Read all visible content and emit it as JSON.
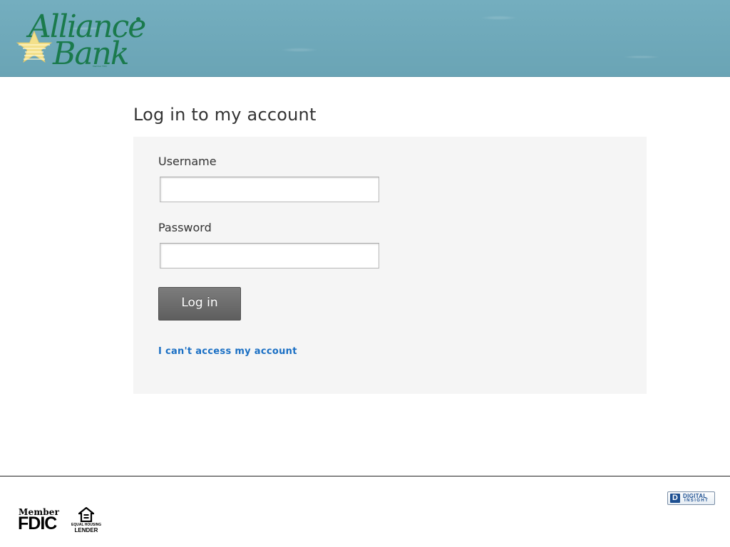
{
  "header": {
    "logo": {
      "line1": "Alliance",
      "line2": "Bank",
      "member_text": "Member FDIC",
      "icon": "star-icon"
    }
  },
  "main": {
    "title": "Log in to my account",
    "username": {
      "label": "Username",
      "value": "",
      "placeholder": ""
    },
    "password": {
      "label": "Password",
      "value": "",
      "placeholder": ""
    },
    "login_button": "Log in",
    "help_link": "I can't access my account"
  },
  "footer": {
    "fdic": {
      "member": "Member",
      "name": "FDIC"
    },
    "equal_housing": {
      "line1": "EQUAL HOUSING",
      "line2": "LENDER",
      "icon": "equal-housing-icon"
    },
    "digital_insight": {
      "mark": "D",
      "line1": "DIGITAL",
      "line2": "INSIGHT"
    }
  },
  "colors": {
    "header_bg": "#6aa4b5",
    "logo_green": "#1a7a4c",
    "star_yellow": "#f3e08a",
    "link_blue": "#1a6fc4",
    "button_gray": "#6b6b6b",
    "panel_bg": "#f5f5f5"
  }
}
